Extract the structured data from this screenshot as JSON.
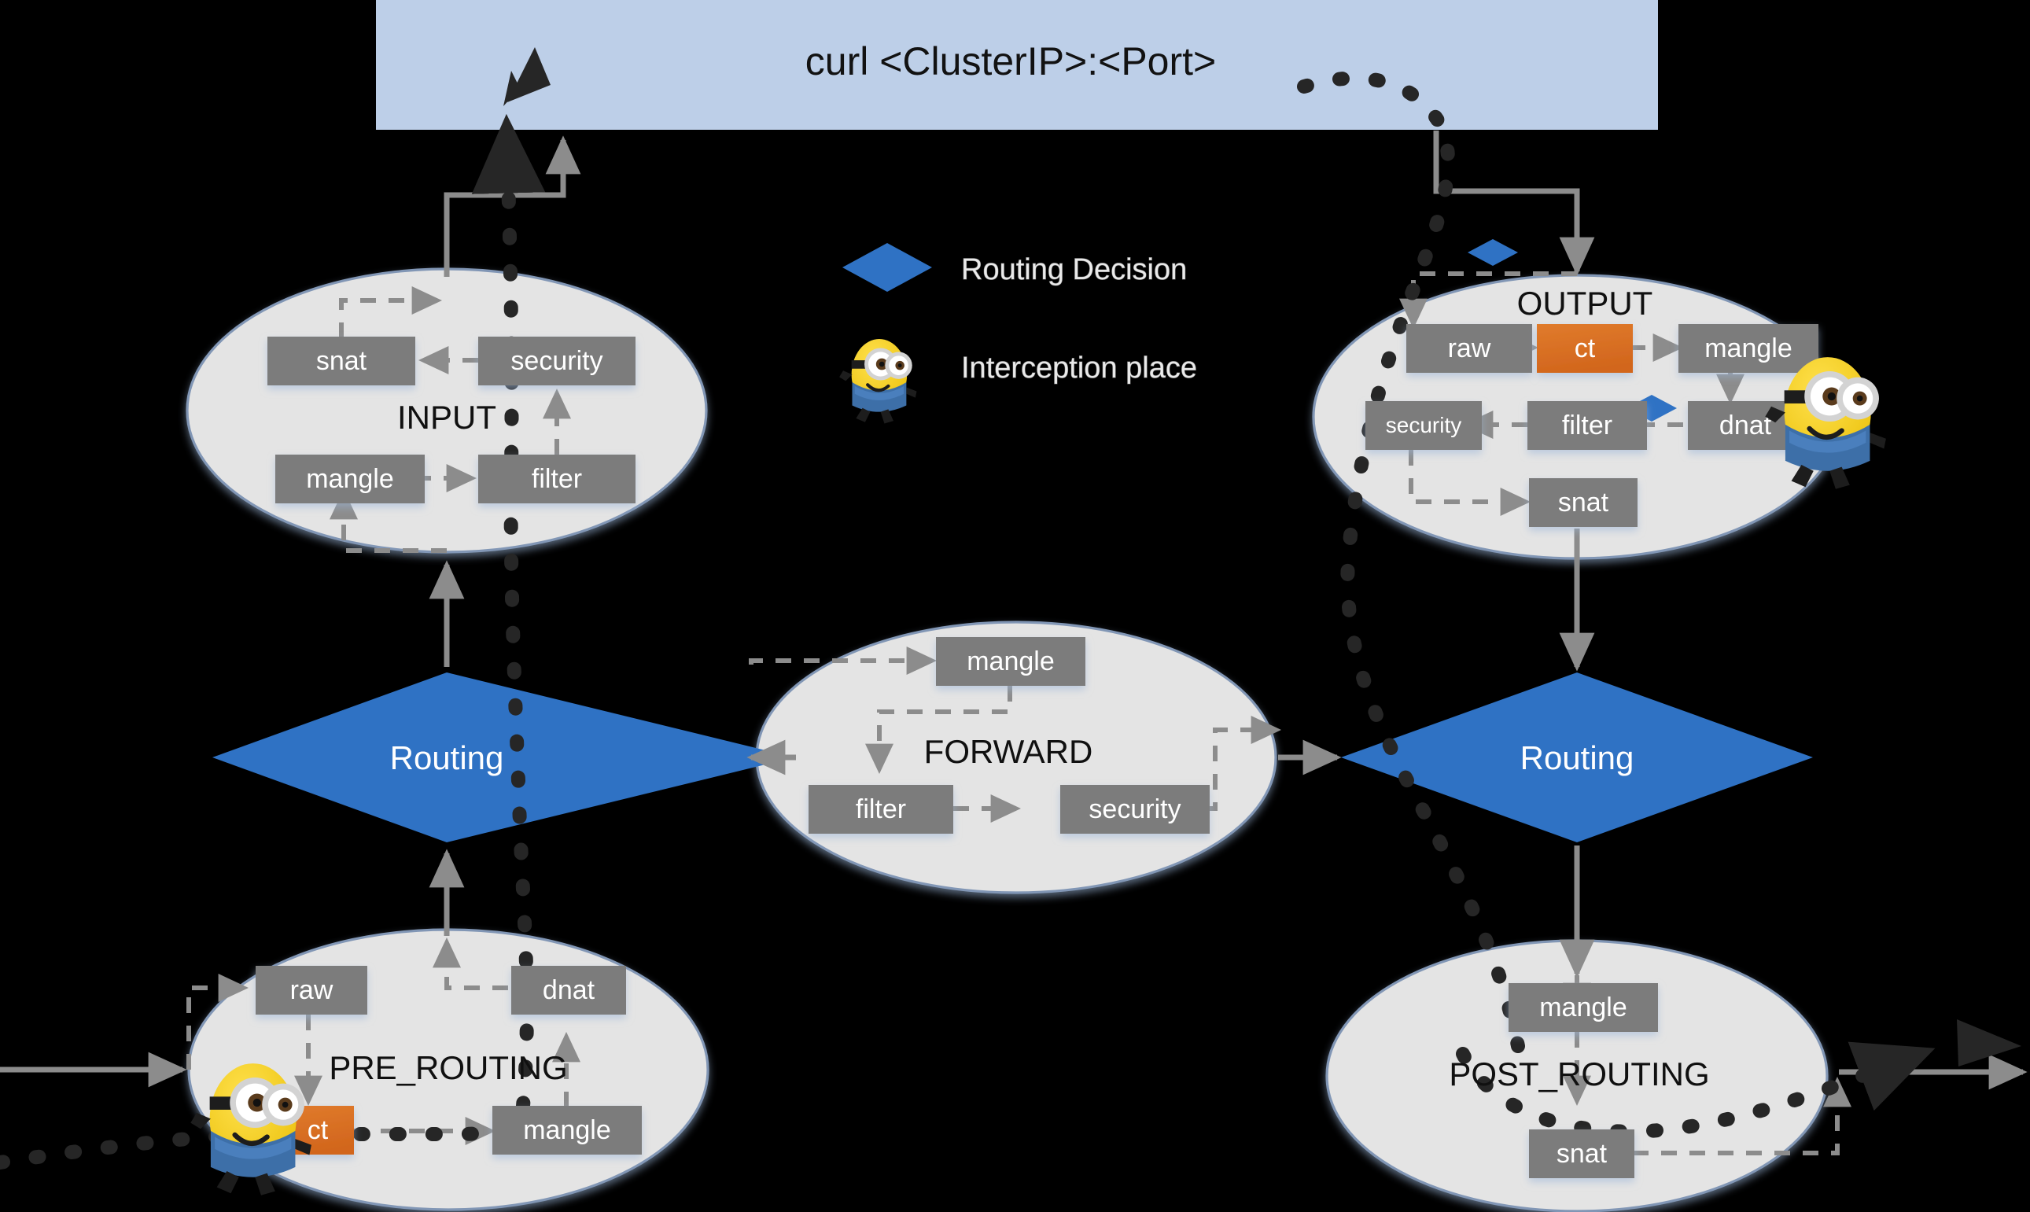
{
  "banner": {
    "text": "curl <ClusterIP>:<Port>",
    "color": "#bdcfe8"
  },
  "legend": {
    "items": [
      {
        "icon": "blue-diamond-icon",
        "label": "Routing Decision",
        "color": "#2f72c4"
      },
      {
        "icon": "minion-icon",
        "label": "Interception place"
      }
    ]
  },
  "colors": {
    "chain_fill": "#e4e4e4",
    "chain_stroke": "#8196b5",
    "table_box": "#7b7b7b",
    "ct_box": "#d96e23",
    "routing_blue": "#2f72c4",
    "arrow_gray": "#8c8c8c",
    "trace_black": "#262626",
    "text_light": "#ffffff",
    "text_dark": "#0d0d0d"
  },
  "chains": [
    {
      "id": "input",
      "name": "INPUT",
      "tables": [
        {
          "name": "snat",
          "kind": "table"
        },
        {
          "name": "security",
          "kind": "table"
        },
        {
          "name": "mangle",
          "kind": "table"
        },
        {
          "name": "filter",
          "kind": "table"
        }
      ],
      "order": [
        "mangle",
        "filter",
        "security",
        "snat"
      ]
    },
    {
      "id": "output",
      "name": "OUTPUT",
      "tables": [
        {
          "name": "raw",
          "kind": "table"
        },
        {
          "name": "ct",
          "kind": "ct"
        },
        {
          "name": "mangle",
          "kind": "table"
        },
        {
          "name": "security",
          "kind": "table"
        },
        {
          "name": "filter",
          "kind": "table"
        },
        {
          "name": "dnat",
          "kind": "table"
        },
        {
          "name": "snat",
          "kind": "table"
        }
      ],
      "order": [
        "raw",
        "ct",
        "mangle",
        "dnat",
        "filter",
        "security",
        "snat"
      ]
    },
    {
      "id": "forward",
      "name": "FORWARD",
      "tables": [
        {
          "name": "mangle",
          "kind": "table"
        },
        {
          "name": "filter",
          "kind": "table"
        },
        {
          "name": "security",
          "kind": "table"
        }
      ],
      "order": [
        "mangle",
        "filter",
        "security"
      ]
    },
    {
      "id": "pre_routing",
      "name": "PRE_ROUTING",
      "tables": [
        {
          "name": "raw",
          "kind": "table"
        },
        {
          "name": "dnat",
          "kind": "table"
        },
        {
          "name": "ct",
          "kind": "ct"
        },
        {
          "name": "mangle",
          "kind": "table"
        }
      ],
      "order": [
        "raw",
        "ct",
        "mangle",
        "dnat"
      ]
    },
    {
      "id": "post_routing",
      "name": "POST_ROUTING",
      "tables": [
        {
          "name": "mangle",
          "kind": "table"
        },
        {
          "name": "snat",
          "kind": "table"
        }
      ],
      "order": [
        "mangle",
        "snat"
      ]
    }
  ],
  "routing_nodes": [
    {
      "id": "routing_left",
      "label": "Routing"
    },
    {
      "id": "routing_right",
      "label": "Routing"
    }
  ],
  "small_diamonds": [
    {
      "id": "diamond_output_top"
    },
    {
      "id": "diamond_output_mid"
    }
  ],
  "text": {
    "input_chain": "INPUT",
    "output_chain": "OUTPUT",
    "forward_chain": "FORWARD",
    "pre_routing_chain": "PRE_ROUTING",
    "post_routing_chain": "POST_ROUTING",
    "routing_left": "Routing",
    "routing_right": "Routing",
    "legend_routing": "Routing Decision",
    "legend_interception": "Interception place",
    "t_input_snat": "snat",
    "t_input_security": "security",
    "t_input_mangle": "mangle",
    "t_input_filter": "filter",
    "t_output_raw": "raw",
    "t_output_ct": "ct",
    "t_output_mangle": "mangle",
    "t_output_security": "security",
    "t_output_filter": "filter",
    "t_output_dnat": "dnat",
    "t_output_snat": "snat",
    "t_forward_mangle": "mangle",
    "t_forward_filter": "filter",
    "t_forward_security": "security",
    "t_pre_raw": "raw",
    "t_pre_dnat": "dnat",
    "t_pre_ct": "ct",
    "t_pre_mangle": "mangle",
    "t_post_mangle": "mangle",
    "t_post_snat": "snat",
    "banner": "curl <ClusterIP>:<Port>"
  }
}
